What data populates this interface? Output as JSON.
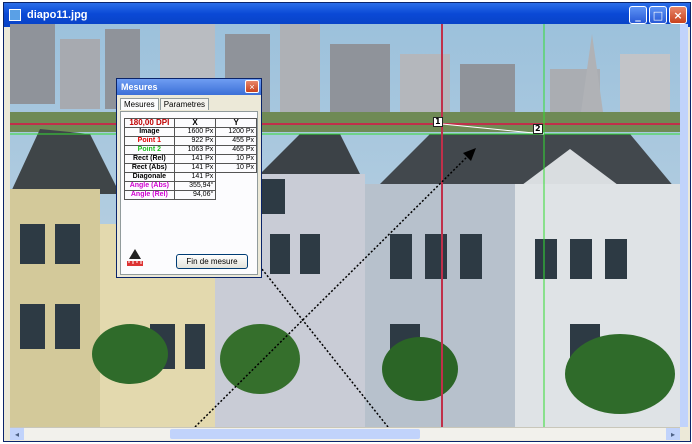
{
  "window": {
    "title": "diapo11.jpg",
    "buttons": {
      "minimize": "_",
      "maximize": "□",
      "close": "×"
    }
  },
  "dialog": {
    "title": "Mesures",
    "close": "×",
    "tabs": [
      "Mesures",
      "Parametres"
    ],
    "table": {
      "header": [
        "180,00 DPI",
        "X",
        "Y"
      ],
      "rows": [
        {
          "label": "Image",
          "x": "1600 Px",
          "y": "1200 Px"
        },
        {
          "label": "Point 1",
          "x": "922 Px",
          "y": "455 Px"
        },
        {
          "label": "Point 2",
          "x": "1063 Px",
          "y": "465 Px"
        },
        {
          "label": "Rect (Rel)",
          "x": "141 Px",
          "y": "10 Px"
        },
        {
          "label": "Rect (Abs)",
          "x": "141 Px",
          "y": "10 Px"
        },
        {
          "label": "Diagonale",
          "x": "141 Px",
          "y": ""
        },
        {
          "label": "Angle (Abs)",
          "x": "355,94°",
          "y": ""
        },
        {
          "label": "Angle (Rel)",
          "x": "94,06°",
          "y": ""
        }
      ]
    },
    "finish_button": "Fin de mesure"
  },
  "markers": {
    "point1": "1",
    "point2": "2"
  },
  "scrollbar": {
    "left_arrow": "◂",
    "right_arrow": "▸"
  },
  "colors": {
    "title_bar": "#0a49d6",
    "dpi": "#c00000",
    "point1": "#e00000",
    "point2": "#20c020",
    "angle": "#d000d0",
    "guide_red": "#c0304a",
    "guide_green": "#33dd33"
  }
}
